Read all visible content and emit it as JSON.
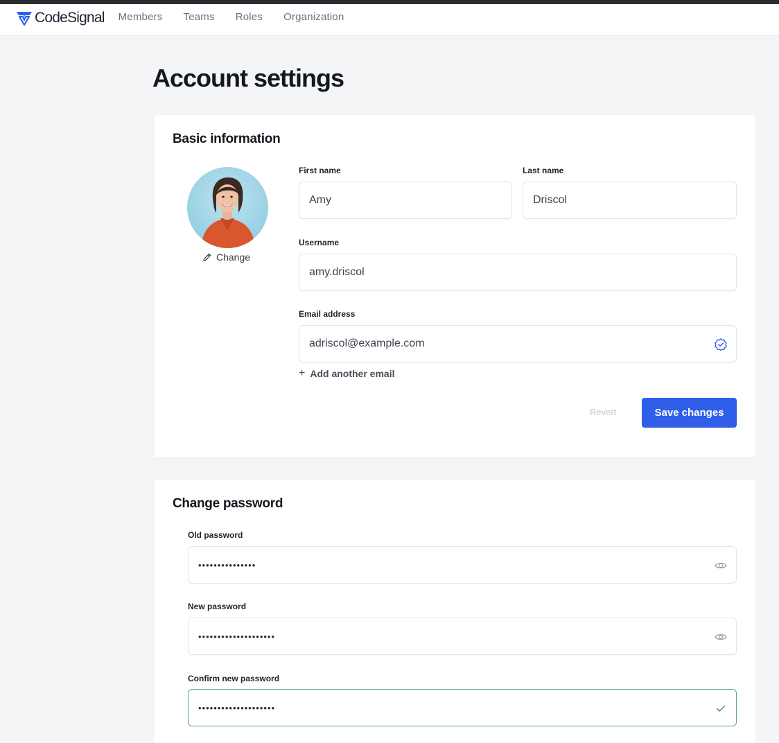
{
  "app": {
    "logo_text": "CodeSignal",
    "nav": [
      "Members",
      "Teams",
      "Roles",
      "Organization"
    ]
  },
  "page": {
    "title": "Account settings"
  },
  "basic_info": {
    "title": "Basic information",
    "change_avatar_label": "Change",
    "first_name": {
      "label": "First name",
      "value": "Amy"
    },
    "last_name": {
      "label": "Last name",
      "value": "Driscol"
    },
    "username": {
      "label": "Username",
      "value": "amy.driscol"
    },
    "email": {
      "label": "Email address",
      "value": "adriscol@example.com",
      "verified": true
    },
    "add_email_label": "Add another email",
    "revert_label": "Revert",
    "save_label": "Save changes"
  },
  "password": {
    "title": "Change password",
    "old": {
      "label": "Old password",
      "value": "•••••••••••••••"
    },
    "new": {
      "label": "New password",
      "value": "••••••••••••••••••••"
    },
    "confirm": {
      "label": "Confirm new password",
      "value": "••••••••••••••••••••",
      "valid": true
    }
  },
  "colors": {
    "primary": "#2f5ee8",
    "success": "#5aa882",
    "page_bg": "#f4f5f7"
  },
  "icons": {
    "logo": "codesignal-logo-icon",
    "change": "pencil-icon",
    "email_verified": "verified-badge-icon",
    "show_password": "eye-icon",
    "confirm_ok": "checkmark-icon"
  }
}
